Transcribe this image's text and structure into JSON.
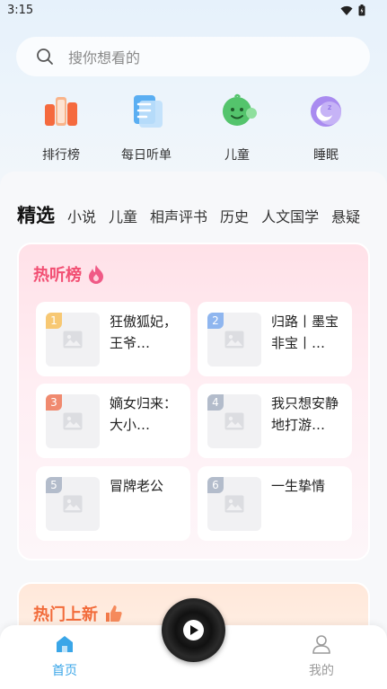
{
  "status_bar": {
    "time": "3:15"
  },
  "search": {
    "placeholder": "搜你想看的"
  },
  "quick_links": [
    {
      "label": "排行榜",
      "icon": "ranking-icon"
    },
    {
      "label": "每日听单",
      "icon": "daily-list-icon"
    },
    {
      "label": "儿童",
      "icon": "children-icon"
    },
    {
      "label": "睡眠",
      "icon": "sleep-icon"
    }
  ],
  "categories": [
    "精选",
    "小说",
    "儿童",
    "相声评书",
    "历史",
    "人文国学",
    "悬疑"
  ],
  "hot_list": {
    "title": "热听榜",
    "items": [
      {
        "rank": "1",
        "title": "狂傲狐妃，王爷…",
        "rank_color": "#f7c873"
      },
      {
        "rank": "2",
        "title": "归路丨墨宝非宝丨…",
        "rank_color": "#8fb6ef"
      },
      {
        "rank": "3",
        "title": "嫡女归来：大小…",
        "rank_color": "#f08a6f"
      },
      {
        "rank": "4",
        "title": "我只想安静地打游…",
        "rank_color": "#b3bccb"
      },
      {
        "rank": "5",
        "title": "冒牌老公",
        "rank_color": "#b3bccb"
      },
      {
        "rank": "6",
        "title": "一生挚情",
        "rank_color": "#b3bccb"
      }
    ]
  },
  "new_section": {
    "title": "热门上新"
  },
  "bottom_nav": {
    "home_label": "首页",
    "mine_label": "我的",
    "active_color": "#3aa6e8",
    "inactive_color": "#9a9a9a"
  }
}
